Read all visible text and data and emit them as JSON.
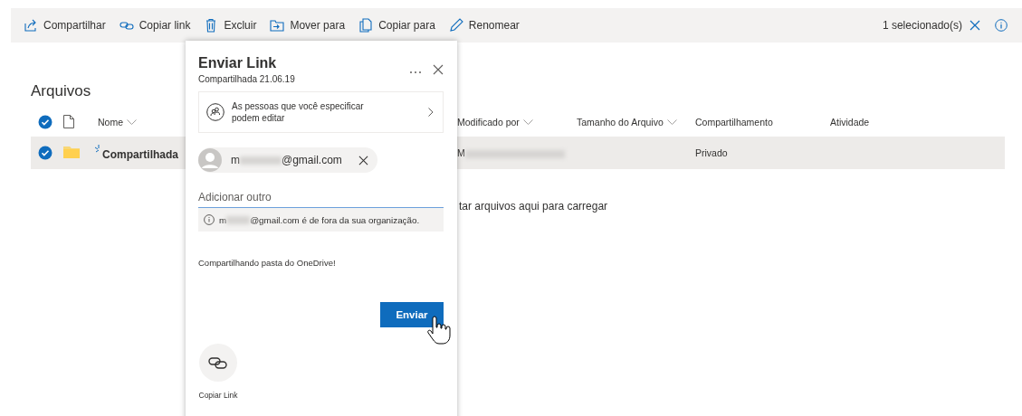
{
  "toolbar": {
    "actions": [
      {
        "kind": "share",
        "label": "Compartilhar"
      },
      {
        "kind": "link",
        "label": "Copiar link"
      },
      {
        "kind": "delete",
        "label": "Excluir"
      },
      {
        "kind": "move",
        "label": "Mover para"
      },
      {
        "kind": "copy",
        "label": "Copiar para"
      },
      {
        "kind": "rename",
        "label": "Renomear"
      }
    ],
    "selection_count": "1 selecionado(s)"
  },
  "page": {
    "title": "Arquivos"
  },
  "table": {
    "all_selected": true,
    "columns": [
      {
        "label": "Nome",
        "sortable": true
      },
      {
        "label": "Modificado por",
        "sortable": true
      },
      {
        "label": "Tamanho do Arquivo",
        "sortable": true
      },
      {
        "label": "Compartilhamento",
        "sortable": false
      },
      {
        "label": "Atividade",
        "sortable": false
      }
    ],
    "rows": [
      {
        "selected": true,
        "new": true,
        "name": "Compartilhada",
        "modified_by": "M",
        "sharing": "Privado"
      }
    ]
  },
  "drop_hint": "tar arquivos aqui para carregar",
  "dialog": {
    "title": "Enviar Link",
    "subtitle": "Compartilhada 21.06.19",
    "permission": "As pessoas que você especificar podem editar",
    "recipients": [
      {
        "prefix": "m",
        "domain": "@gmail.com"
      }
    ],
    "add_field": {
      "placeholder": "Adicionar outro"
    },
    "warning": {
      "prefix": "m",
      "suffix": "@gmail.com é de fora da sua organização."
    },
    "message": "Compartilhando pasta do OneDrive!",
    "send": "Enviar",
    "options": [
      {
        "kind": "copy-link",
        "label": "Copiar Link"
      }
    ]
  }
}
